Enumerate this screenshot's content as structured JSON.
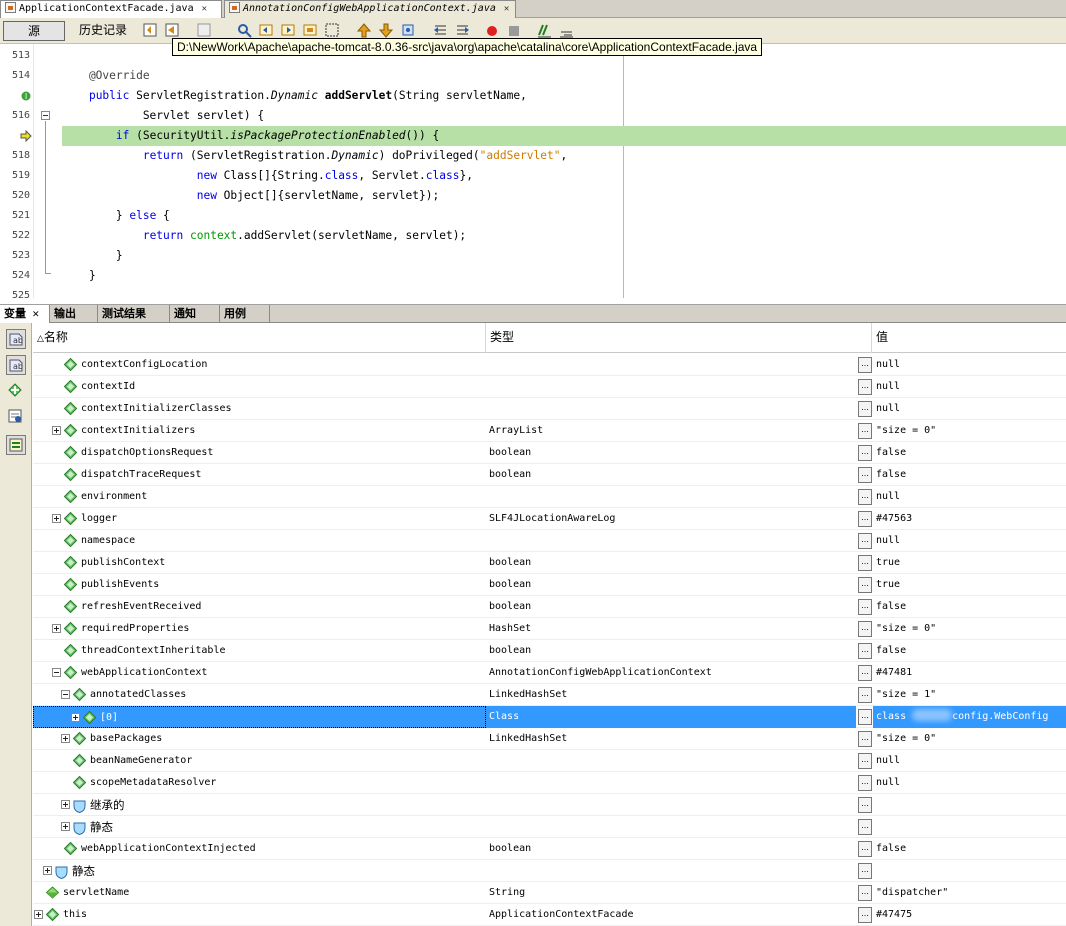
{
  "editor_tabs": [
    {
      "label": "ApplicationContextFacade.java",
      "active": true
    },
    {
      "label": "AnnotationConfigWebApplicationContext.java",
      "active": false
    }
  ],
  "toolbar": {
    "source_label": "源",
    "history_label": "历史记录"
  },
  "tooltip": "D:\\NewWork\\Apache\\apache-tomcat-8.0.36-src\\java\\org\\apache\\catalina\\core\\ApplicationContextFacade.java",
  "code": {
    "line_numbers": [
      "513",
      "514",
      "",
      "516",
      "",
      "518",
      "519",
      "520",
      "521",
      "522",
      "523",
      "524",
      "525"
    ]
  },
  "debug_tabs": [
    "变量",
    "输出",
    "测试结果",
    "通知",
    "用例"
  ],
  "vars_header": {
    "name": "名称",
    "type": "类型",
    "value": "值"
  },
  "variables": [
    {
      "name": "contextConfigLocation",
      "type": "",
      "value": "null"
    },
    {
      "name": "contextId",
      "type": "",
      "value": "null"
    },
    {
      "name": "contextInitializerClasses",
      "type": "",
      "value": "null"
    },
    {
      "name": "contextInitializers",
      "type": "ArrayList",
      "value": "\"size = 0\""
    },
    {
      "name": "dispatchOptionsRequest",
      "type": "boolean",
      "value": "false"
    },
    {
      "name": "dispatchTraceRequest",
      "type": "boolean",
      "value": "false"
    },
    {
      "name": "environment",
      "type": "",
      "value": "null"
    },
    {
      "name": "logger",
      "type": "SLF4JLocationAwareLog",
      "value": "#47563"
    },
    {
      "name": "namespace",
      "type": "",
      "value": "null"
    },
    {
      "name": "publishContext",
      "type": "boolean",
      "value": "true"
    },
    {
      "name": "publishEvents",
      "type": "boolean",
      "value": "true"
    },
    {
      "name": "refreshEventReceived",
      "type": "boolean",
      "value": "false"
    },
    {
      "name": "requiredProperties",
      "type": "HashSet",
      "value": "\"size = 0\""
    },
    {
      "name": "threadContextInheritable",
      "type": "boolean",
      "value": "false"
    },
    {
      "name": "webApplicationContext",
      "type": "AnnotationConfigWebApplicationContext",
      "value": "#47481"
    },
    {
      "name": "annotatedClasses",
      "type": "LinkedHashSet",
      "value": "\"size = 1\""
    },
    {
      "name": "[0]",
      "type": "Class",
      "value_prefix": "class ",
      "value_suffix": "config.WebConfig"
    },
    {
      "name": "basePackages",
      "type": "LinkedHashSet",
      "value": "\"size = 0\""
    },
    {
      "name": "beanNameGenerator",
      "type": "",
      "value": "null"
    },
    {
      "name": "scopeMetadataResolver",
      "type": "",
      "value": "null"
    },
    {
      "name": "继承的",
      "type": "",
      "value": ""
    },
    {
      "name": "静态",
      "type": "",
      "value": ""
    },
    {
      "name": "webApplicationContextInjected",
      "type": "boolean",
      "value": "false"
    },
    {
      "name": "静态",
      "type": "",
      "value": ""
    },
    {
      "name": "servletName",
      "type": "String",
      "value": "\"dispatcher\""
    },
    {
      "name": "this",
      "type": "ApplicationContextFacade",
      "value": "#47475"
    }
  ],
  "colors": {
    "selection": "#3399ff",
    "current_line": "#b6e0a6",
    "keyword": "#0000e6",
    "string": "#ce7b00"
  }
}
